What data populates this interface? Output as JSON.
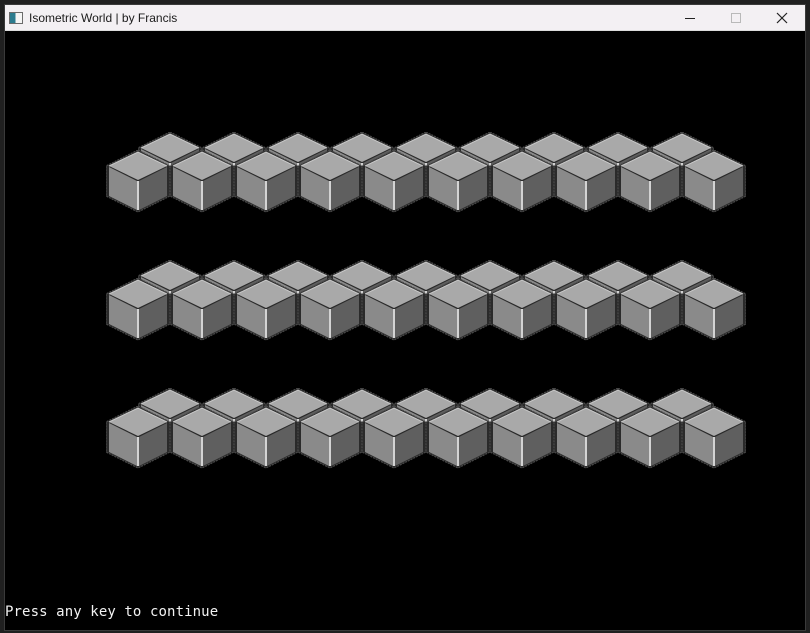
{
  "window": {
    "title": "Isometric World | by Francis",
    "icon": "app-window-icon",
    "controls": {
      "minimize": "minimize-icon",
      "maximize": "maximize-icon",
      "close": "close-icon"
    }
  },
  "scene": {
    "rows": 3,
    "cubes_per_row": 19,
    "block_color": "#8d8d8d",
    "background_color": "#000000"
  },
  "status": {
    "message": "Press any key to continue"
  }
}
